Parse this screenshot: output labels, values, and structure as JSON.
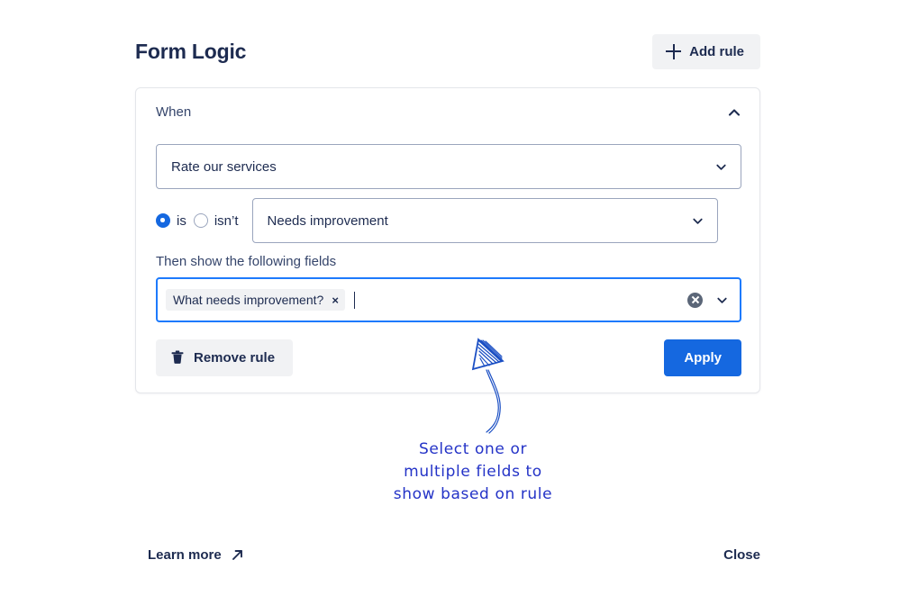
{
  "header": {
    "title": "Form Logic",
    "add_rule_label": "Add rule",
    "add_rule_icon": "plus-icon"
  },
  "rule": {
    "when_label": "When",
    "collapse_icon": "chevron-up-icon",
    "field_select": {
      "value": "Rate our services",
      "icon": "chevron-down-icon"
    },
    "condition": {
      "options": [
        {
          "label": "is",
          "selected": true
        },
        {
          "label": "isn’t",
          "selected": false
        }
      ],
      "value_select": {
        "value": "Needs improvement",
        "icon": "chevron-down-icon"
      }
    },
    "then_label": "Then show the following fields",
    "fields_multiselect": {
      "chips": [
        {
          "label": "What needs improvement?",
          "remove_icon": "close-x-icon",
          "remove_label": "×"
        }
      ],
      "clear_icon": "clear-circle-icon",
      "dropdown_icon": "chevron-down-icon",
      "focused": true
    },
    "remove_rule_label": "Remove rule",
    "remove_rule_icon": "trash-icon",
    "apply_label": "Apply"
  },
  "footer": {
    "learn_more_label": "Learn more",
    "learn_more_icon": "external-link-icon",
    "close_label": "Close"
  },
  "annotation": {
    "icon": "hand-drawn-arrow",
    "line1": "Select one or",
    "line2": "multiple fields to",
    "line3": "show based on rule"
  },
  "colors": {
    "accent_blue": "#1568e0",
    "focus_blue": "#1d7afc",
    "text_navy": "#1d2b50",
    "muted_grey": "#f1f2f4",
    "border_grey": "#9aa5bd",
    "annotation_blue": "#2433c7"
  }
}
